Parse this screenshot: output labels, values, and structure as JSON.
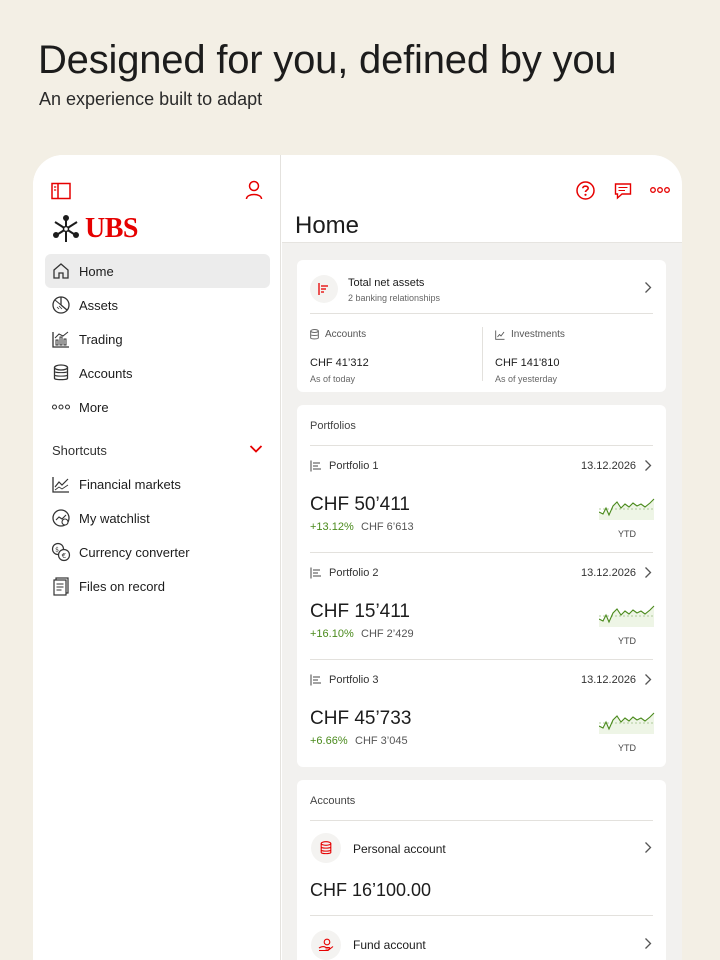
{
  "hero": {
    "title": "Designed for you, defined by you",
    "subtitle": "An experience built to adapt"
  },
  "brand": {
    "name": "UBS",
    "accent": "#e60000",
    "positive": "#4a8a1c"
  },
  "sidebar": {
    "top_icons": [
      "sidebar-toggle-icon",
      "profile-icon"
    ],
    "items": [
      {
        "label": "Home",
        "icon": "home-icon",
        "active": true
      },
      {
        "label": "Assets",
        "icon": "pie-chart-icon",
        "active": false
      },
      {
        "label": "Trading",
        "icon": "trading-chart-icon",
        "active": false
      },
      {
        "label": "Accounts",
        "icon": "database-icon",
        "active": false
      },
      {
        "label": "More",
        "icon": "more-dots-icon",
        "active": false
      }
    ],
    "shortcuts_label": "Shortcuts",
    "shortcuts": [
      {
        "label": "Financial markets",
        "icon": "line-chart-icon"
      },
      {
        "label": "My watchlist",
        "icon": "watchlist-icon"
      },
      {
        "label": "Currency converter",
        "icon": "currency-icon"
      },
      {
        "label": "Files on record",
        "icon": "files-icon"
      }
    ]
  },
  "header": {
    "title": "Home",
    "icons": [
      "help-icon",
      "chat-icon",
      "more-icon"
    ]
  },
  "total_net_assets": {
    "title": "Total net assets",
    "subtitle": "2 banking relationships",
    "accounts": {
      "label": "Accounts",
      "amount": "CHF 41’312",
      "as_of": "As of today"
    },
    "investments": {
      "label": "Investments",
      "amount": "CHF 141'810",
      "as_of": "As of yesterday"
    }
  },
  "portfolios": {
    "label": "Portfolios",
    "items": [
      {
        "name": "Portfolio 1",
        "date": "13.12.2026",
        "amount": "CHF 50’411",
        "pct": "+13.12%",
        "gain": "CHF 6’613",
        "period": "YTD"
      },
      {
        "name": "Portfolio 2",
        "date": "13.12.2026",
        "amount": "CHF 15’411",
        "pct": "+16.10%",
        "gain": "CHF 2’429",
        "period": "YTD"
      },
      {
        "name": "Portfolio 3",
        "date": "13.12.2026",
        "amount": "CHF 45’733",
        "pct": "+6.66%",
        "gain": "CHF 3’045",
        "period": "YTD"
      }
    ]
  },
  "accounts_card": {
    "label": "Accounts",
    "items": [
      {
        "name": "Personal account",
        "amount": "CHF 16’100.00",
        "icon": "database-icon"
      },
      {
        "name": "Fund account",
        "icon": "fund-icon"
      }
    ]
  }
}
